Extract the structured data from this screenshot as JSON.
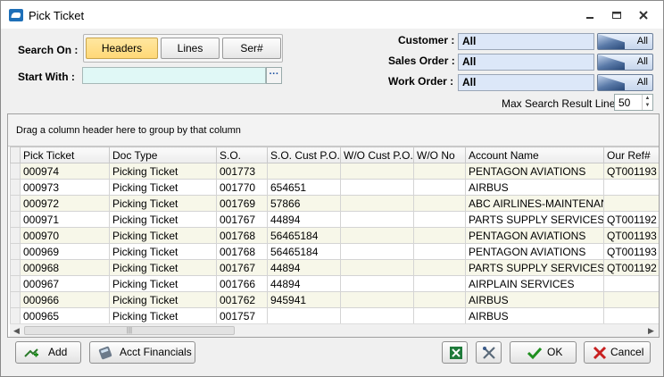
{
  "window": {
    "title": "Pick Ticket"
  },
  "search": {
    "search_on_label": "Search On :",
    "start_with_label": "Start With :",
    "start_with_value": "",
    "ellipsis": "···",
    "modes": [
      "Headers",
      "Lines",
      "Ser#"
    ],
    "active_mode": "Headers"
  },
  "filters": {
    "customer": {
      "label": "Customer :",
      "value": "All",
      "button": "All"
    },
    "sales_order": {
      "label": "Sales Order :",
      "value": "All",
      "button": "All"
    },
    "work_order": {
      "label": "Work Order :",
      "value": "All",
      "button": "All"
    },
    "max_lines": {
      "label": "Max Search Result Lines :",
      "value": "50"
    }
  },
  "grid": {
    "group_hint": "Drag a column header here to group by that column",
    "columns": [
      "Pick Ticket",
      "Doc Type",
      "S.O.",
      "S.O. Cust P.O.",
      "W/O Cust P.O.",
      "W/O No",
      "Account Name",
      "Our Ref#"
    ],
    "rows": [
      [
        "000974",
        "Picking Ticket",
        "001773",
        "",
        "",
        "",
        "PENTAGON AVIATIONS",
        "QT001193"
      ],
      [
        "000973",
        "Picking Ticket",
        "001770",
        "654651",
        "",
        "",
        "AIRBUS",
        ""
      ],
      [
        "000972",
        "Picking Ticket",
        "001769",
        "57866",
        "",
        "",
        "ABC AIRLINES-MAINTENANCE",
        ""
      ],
      [
        "000971",
        "Picking Ticket",
        "001767",
        "44894",
        "",
        "",
        "PARTS SUPPLY SERVICES, INC",
        "QT001192"
      ],
      [
        "000970",
        "Picking Ticket",
        "001768",
        "56465184",
        "",
        "",
        "PENTAGON AVIATIONS",
        "QT001193"
      ],
      [
        "000969",
        "Picking Ticket",
        "001768",
        "56465184",
        "",
        "",
        "PENTAGON AVIATIONS",
        "QT001193"
      ],
      [
        "000968",
        "Picking Ticket",
        "001767",
        "44894",
        "",
        "",
        "PARTS SUPPLY SERVICES, INC",
        "QT001192"
      ],
      [
        "000967",
        "Picking Ticket",
        "001766",
        "44894",
        "",
        "",
        "AIRPLAIN SERVICES",
        ""
      ],
      [
        "000966",
        "Picking Ticket",
        "001762",
        "945941",
        "",
        "",
        "AIRBUS",
        ""
      ],
      [
        "000965",
        "Picking Ticket",
        "001757",
        "",
        "",
        "",
        "AIRBUS",
        ""
      ]
    ]
  },
  "buttons": {
    "add": "Add",
    "acct_financials": "Acct Financials",
    "ok": "OK",
    "cancel": "Cancel"
  },
  "colors": {
    "active_mode": "#ffd877",
    "filter_field": "#dce7f8",
    "start_field": "#e0f8f6",
    "row_alt": "#f7f7e9"
  },
  "icons": {
    "app": "pick-ticket-app-icon",
    "add": "add-icon",
    "acct": "calculator-icon",
    "excel": "excel-icon",
    "tools": "tools-icon",
    "ok": "checkmark-icon",
    "cancel": "x-icon"
  }
}
